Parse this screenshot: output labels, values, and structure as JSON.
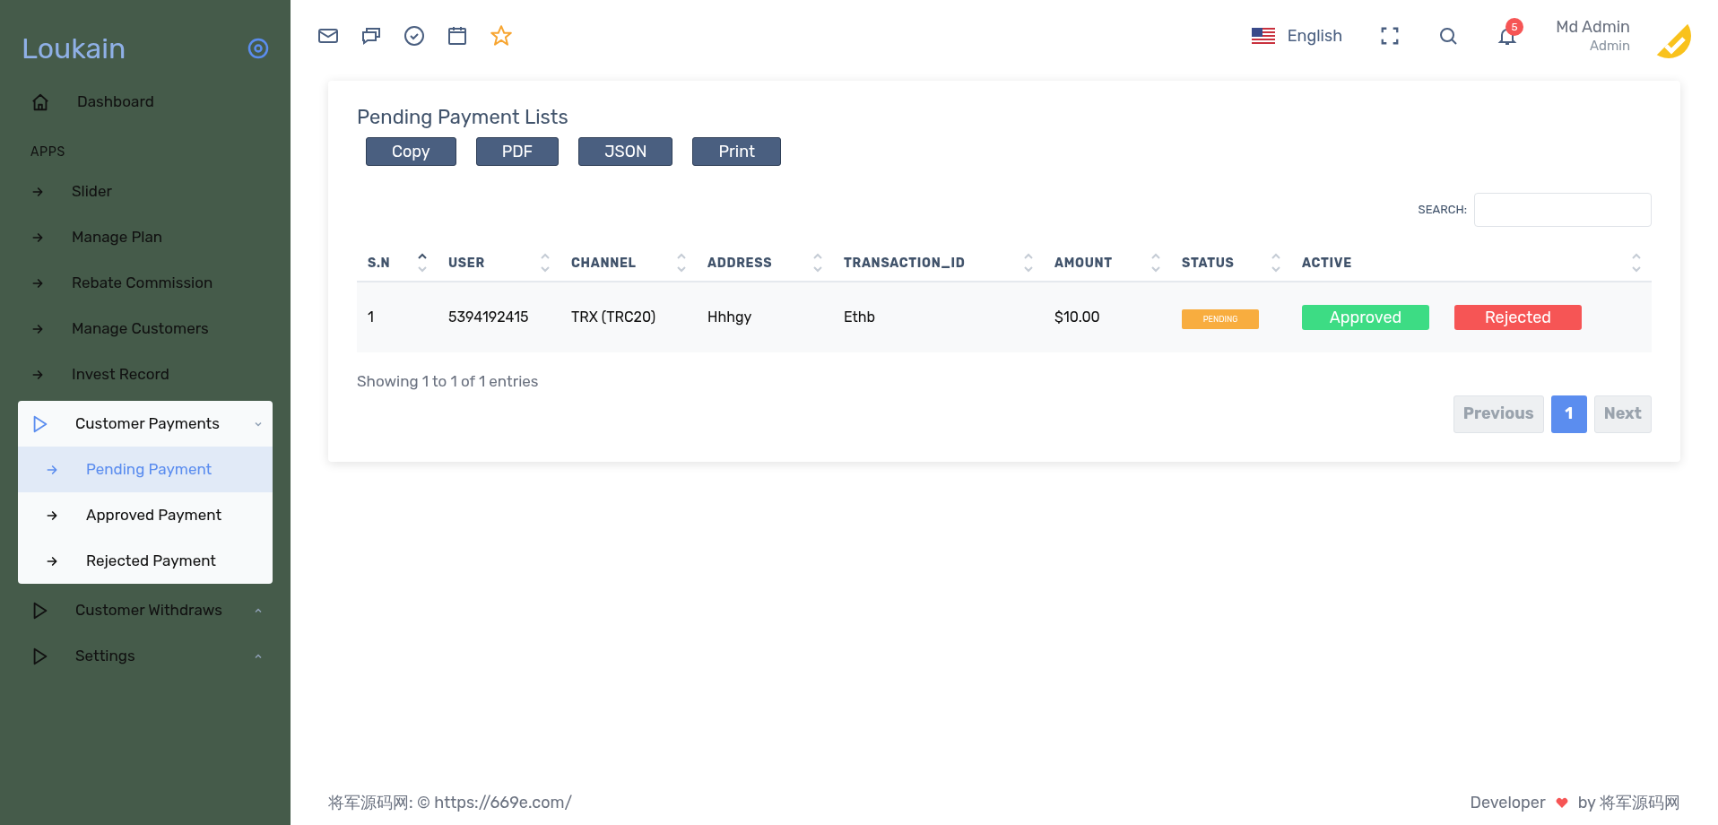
{
  "sidebar": {
    "logo": "Loukain",
    "items": [
      {
        "kind": "home",
        "label": "Dashboard"
      },
      {
        "kind": "section",
        "label": "APPS"
      },
      {
        "kind": "link",
        "label": "Slider"
      },
      {
        "kind": "link",
        "label": "Manage Plan"
      },
      {
        "kind": "link",
        "label": "Rebate Commission"
      },
      {
        "kind": "link",
        "label": "Manage Customers"
      },
      {
        "kind": "link",
        "label": "Invest Record"
      },
      {
        "kind": "group",
        "label": "Customer Payments",
        "expanded": true,
        "children": [
          {
            "label": "Pending Payment",
            "selected": true
          },
          {
            "label": "Approved Payment",
            "selected": false
          },
          {
            "label": "Rejected Payment",
            "selected": false
          }
        ]
      },
      {
        "kind": "group",
        "label": "Customer Withdraws",
        "expanded": false
      },
      {
        "kind": "group",
        "label": "Settings",
        "expanded": false
      }
    ]
  },
  "header": {
    "language": "English",
    "notifications": "5",
    "user_name": "Md Admin",
    "user_role": "Admin"
  },
  "card": {
    "title": "Pending Payment Lists",
    "buttons": [
      "Copy",
      "PDF",
      "JSON",
      "Print"
    ],
    "search_label": "SEARCH:",
    "table": {
      "columns": [
        {
          "label": "S.N",
          "sorted": true
        },
        {
          "label": "USER",
          "sorted": false
        },
        {
          "label": "CHANNEL",
          "sorted": false
        },
        {
          "label": "ADDRESS",
          "sorted": false
        },
        {
          "label": "TRANSACTION_ID",
          "sorted": false
        },
        {
          "label": "AMOUNT",
          "sorted": false
        },
        {
          "label": "STATUS",
          "sorted": false
        },
        {
          "label": "ACTIVE",
          "sorted": false
        }
      ],
      "rows": [
        {
          "cells": [
            "1",
            "5394192415",
            "TRX (TRC20)",
            "Hhhgy",
            "Ethb",
            "$10.00"
          ],
          "status": "PENDING",
          "actions": [
            "Approved",
            "Rejected"
          ]
        }
      ]
    },
    "info": "Showing 1 to 1 of 1 entries",
    "pagination": [
      {
        "label": "Previous",
        "selected": false
      },
      {
        "label": "1",
        "selected": true
      },
      {
        "label": "Next",
        "selected": false
      }
    ]
  },
  "footer": {
    "left": "将军源码网: © https://669e.com/",
    "developer": "Developer",
    "by": "by 将军源码网"
  }
}
